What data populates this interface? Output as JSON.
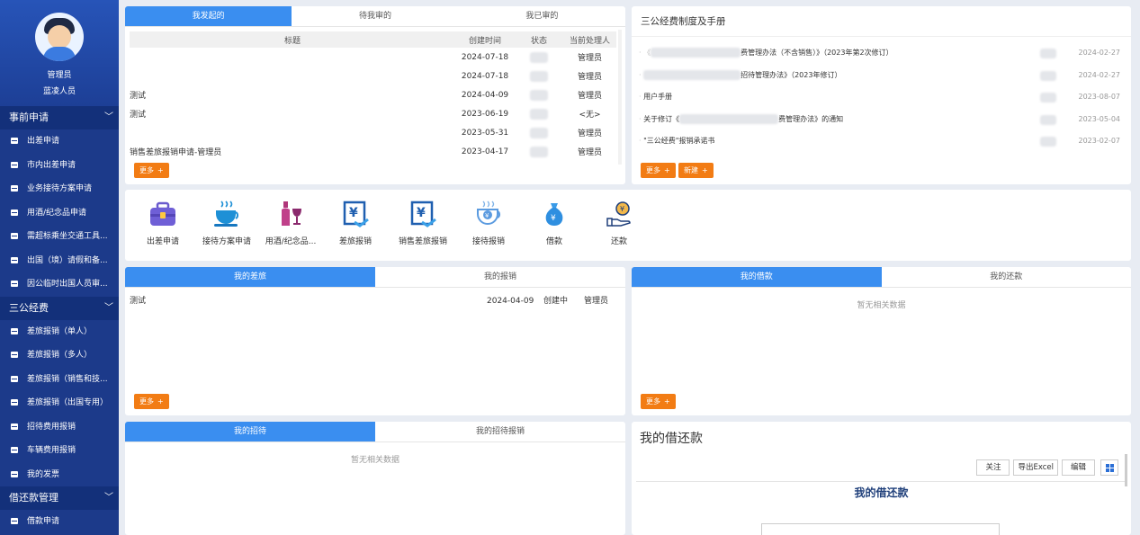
{
  "user": {
    "name": "管理员",
    "dept": "蓝凌人员"
  },
  "sidebar": {
    "groups": [
      {
        "title": "事前申请",
        "items": [
          "出差申请",
          "市内出差申请",
          "业务接待方案申请",
          "用酒/纪念品申请",
          "需超标乘坐交通工具...",
          "出国（境）请假和备...",
          "因公临时出国人员审..."
        ]
      },
      {
        "title": "三公经费",
        "items": [
          "差旅报销（单人）",
          "差旅报销（多人）",
          "差旅报销（销售和技...",
          "差旅报销（出国专用）",
          "招待费用报销",
          "车辆费用报销",
          "我的发票"
        ]
      },
      {
        "title": "借还款管理",
        "items": [
          "借款申请"
        ]
      }
    ]
  },
  "approvals": {
    "tabs": [
      "我发起的",
      "待我审的",
      "我已审的"
    ],
    "columns": [
      "标题",
      "创建时间",
      "状态",
      "当前处理人"
    ],
    "rows": [
      {
        "title": "",
        "date": "2024-07-18",
        "status": "",
        "handler": "管理员"
      },
      {
        "title": "",
        "date": "2024-07-18",
        "status": "",
        "handler": "管理员"
      },
      {
        "title": "测试",
        "date": "2024-04-09",
        "status": "",
        "handler": "管理员"
      },
      {
        "title": "测试",
        "date": "2023-06-19",
        "status": "",
        "handler": "<无>"
      },
      {
        "title": "",
        "date": "2023-05-31",
        "status": "",
        "handler": "管理员"
      },
      {
        "title": "销售差旅报销申请-管理员",
        "date": "2023-04-17",
        "status": "",
        "handler": "管理员"
      }
    ],
    "more_label": "更多"
  },
  "policy": {
    "title": "三公经费制度及手册",
    "items": [
      {
        "title": "费管理办法（不含销售）》（2023年第2次修订）",
        "date": "2024-02-27"
      },
      {
        "title": "招待管理办法》（2023年修订）",
        "date": "2024-02-27"
      },
      {
        "title": "用户手册",
        "date": "2023-08-07"
      },
      {
        "title": "关于修订《",
        "title_tail": "费管理办法》的通知",
        "date": "2023-05-04"
      },
      {
        "title": "\"三公经费\"报销承诺书",
        "date": "2023-02-07"
      }
    ],
    "more_label": "更多",
    "new_label": "新建"
  },
  "quick_links": [
    {
      "label": "出差申请",
      "icon": "suitcase-icon"
    },
    {
      "label": "接待方案申请",
      "icon": "coffee-cup-icon"
    },
    {
      "label": "用酒/纪念品...",
      "icon": "wine-icon"
    },
    {
      "label": "差旅报销",
      "icon": "yen-receipt-icon"
    },
    {
      "label": "销售差旅报销",
      "icon": "yen-receipt-icon"
    },
    {
      "label": "接待报销",
      "icon": "yen-cup-icon"
    },
    {
      "label": "借款",
      "icon": "money-bag-icon"
    },
    {
      "label": "还款",
      "icon": "hand-coin-icon"
    }
  ],
  "trips": {
    "tabs": [
      "我的差旅",
      "我的报销"
    ],
    "rows": [
      {
        "title": "测试",
        "date": "2024-04-09",
        "status": "创建中",
        "handler": "管理员"
      }
    ],
    "more_label": "更多"
  },
  "loans": {
    "tabs": [
      "我的借款",
      "我的还款"
    ],
    "empty": "暂无相关数据",
    "more_label": "更多"
  },
  "receptions": {
    "tabs": [
      "我的招待",
      "我的招待报销"
    ],
    "empty": "暂无相关数据"
  },
  "loan_report": {
    "title": "我的借还款",
    "buttons": [
      "关注",
      "导出Excel",
      "编辑"
    ],
    "report_title": "我的借还款"
  },
  "colors": {
    "sidebar": "#1c3a8a",
    "tab_active": "#3a8ef0",
    "more_button": "#f27c14"
  }
}
